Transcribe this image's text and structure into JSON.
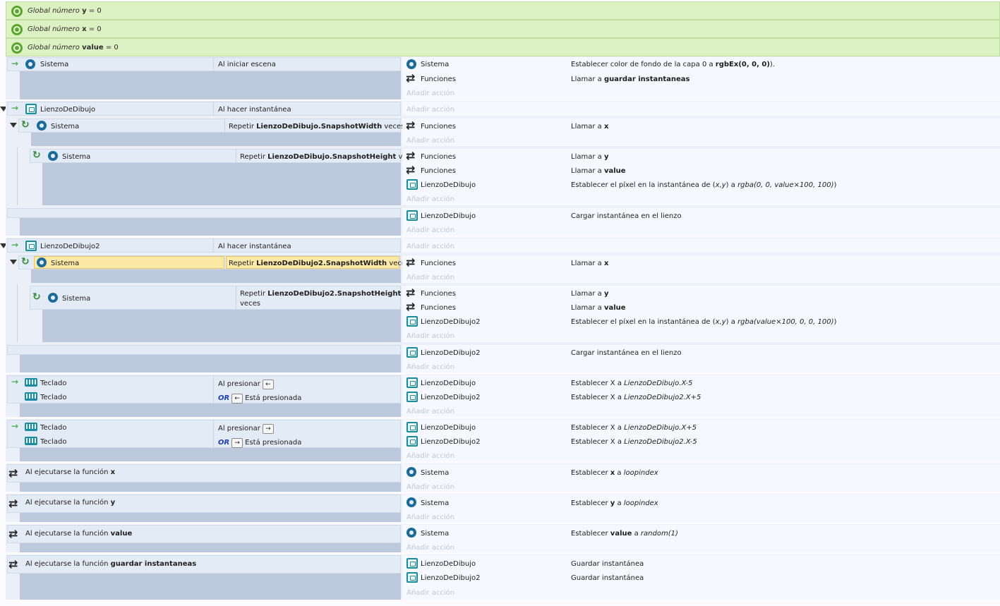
{
  "globals": [
    {
      "prefix": "Global número",
      "name": "y",
      "suffix": "= 0"
    },
    {
      "prefix": "Global número",
      "name": "x",
      "suffix": "= 0"
    },
    {
      "prefix": "Global número",
      "name": "value",
      "suffix": "= 0"
    }
  ],
  "add_action": "Añadir acción",
  "labels": {
    "sistema": "Sistema",
    "funciones": "Funciones",
    "lienzo1": "LienzoDeDibujo",
    "lienzo2": "LienzoDeDibujo2",
    "teclado": "Teclado",
    "al_iniciar": "Al iniciar escena",
    "al_hacer": "Al hacer instantánea",
    "repetir": "Repetir",
    "veces": "veces",
    "al_presionar": "Al presionar",
    "esta_presionada": "Está presionada",
    "or": "OR",
    "key_left": "←",
    "key_right": "→"
  },
  "rows": {
    "e1_a1_pre": "Establecer color de fondo de la capa 0 a ",
    "e1_a1_bold": "rgbEx(0, 0, 0)",
    "e1_a1_post": ").",
    "e1_a2_pre": "Llamar a ",
    "e1_a2_bold": "guardar instantaneas",
    "loop1_expr": "LienzoDeDibujo.SnapshotWidth",
    "loop2_expr": "LienzoDeDibujo.SnapshotHeight",
    "loop3_expr": "LienzoDeDibujo2.SnapshotWidth",
    "loop4_expr": "LienzoDeDibujo2.SnapshotHeight",
    "call_pre": "Llamar a ",
    "x": "x",
    "y": "y",
    "value": "value",
    "setpixel_pre": "Establecer el píxel en la instantánea de (",
    "setpixel_xy": "x,y",
    "setpixel_mid": ") a ",
    "setpixel1_val": "rgba(0, 0, value×100, 100)",
    "setpixel2_val": "rgba(value×100, 0, 0, 100)",
    "setpixel_post": ")",
    "load": "Cargar instantánea en el lienzo",
    "setx_pre": "Establecer X a ",
    "k1_a1": "LienzoDeDibujo.X-5",
    "k1_a2": "LienzoDeDibujo2.X+5",
    "k2_a1": "LienzoDeDibujo.X+5",
    "k2_a2": "LienzoDeDibujo2.X-5",
    "fn_pre": "Al ejecutarse la función ",
    "fn_guardar": "guardar instantaneas",
    "set_pre": "Establecer ",
    "set_mid": " a ",
    "loopindex": "loopindex",
    "random": "random(1)",
    "save": "Guardar instantánea"
  }
}
